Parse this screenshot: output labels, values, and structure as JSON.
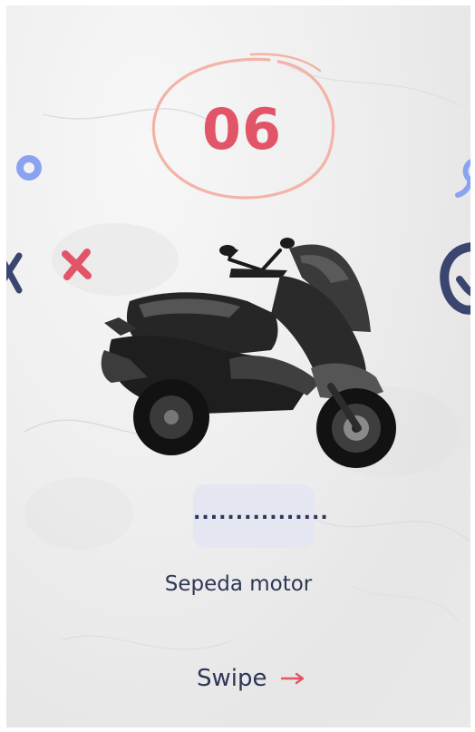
{
  "slide": {
    "number": "06",
    "answer_placeholder": "................",
    "label": "Sepeda motor",
    "swipe_label": "Swipe"
  },
  "icons": {
    "arrow": "arrow-right-icon",
    "ring": "hand-drawn-ring-icon",
    "circle": "circle-icon",
    "cross": "cross-icon",
    "squiggle": "squiggle-icon",
    "scooter": "scooter-motorcycle-icon"
  },
  "colors": {
    "accent": "#e25467",
    "ring": "#f3b3a6",
    "text": "#2e3656",
    "navy": "#3b4670",
    "blue_dot": "#8aa3f0",
    "answer_box": "#e4e6f2"
  }
}
